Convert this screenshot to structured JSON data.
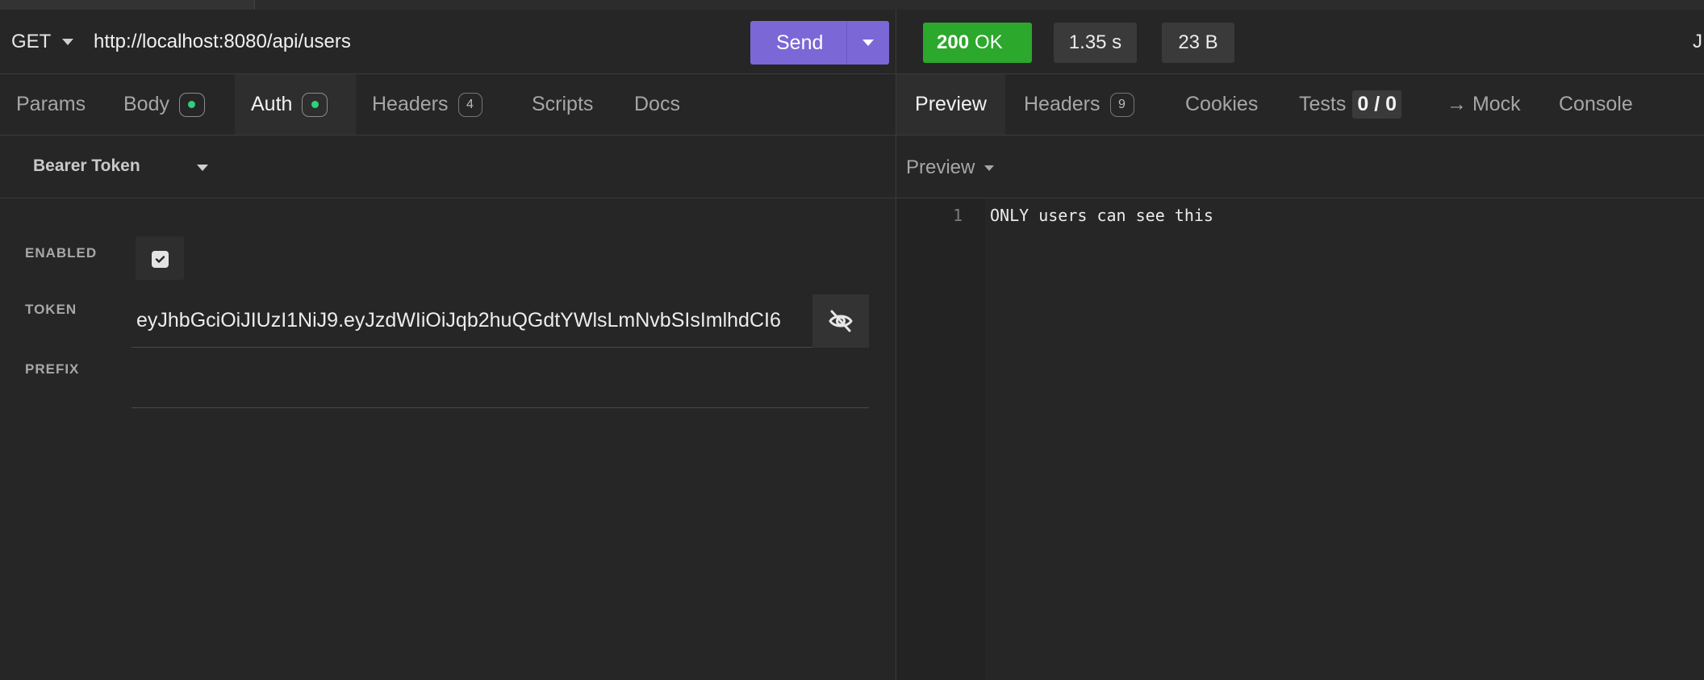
{
  "request": {
    "method": "GET",
    "url": "http://localhost:8080/api/users",
    "send_label": "Send"
  },
  "request_tabs": [
    {
      "label": "Params"
    },
    {
      "label": "Body",
      "badge": "dot"
    },
    {
      "label": "Auth",
      "badge": "dot",
      "active": true
    },
    {
      "label": "Headers",
      "badge": "4"
    },
    {
      "label": "Scripts"
    },
    {
      "label": "Docs"
    }
  ],
  "auth": {
    "type_label": "Bearer Token",
    "enabled_label": "ENABLED",
    "enabled": true,
    "token_label": "TOKEN",
    "token_value": "eyJhbGciOiJIUzI1NiJ9.eyJzdWIiOiJqb2huQGdtYWlsLmNvbSIsImlhdCI6",
    "prefix_label": "PREFIX",
    "prefix_value": ""
  },
  "response": {
    "status_code": "200",
    "status_text": "OK",
    "time": "1.35 s",
    "size": "23 B",
    "edge_letter": "J"
  },
  "response_tabs": [
    {
      "label": "Preview",
      "active": true
    },
    {
      "label": "Headers",
      "badge": "9"
    },
    {
      "label": "Cookies"
    },
    {
      "label": "Tests",
      "count": "0 / 0"
    },
    {
      "label": "→ Mock"
    },
    {
      "label": "Console"
    }
  ],
  "preview": {
    "mode_label": "Preview",
    "lines": [
      {
        "number": "1",
        "text": "ONLY users can see this"
      }
    ]
  },
  "colors": {
    "accent": "#7b68d6",
    "status_ok": "#2ca82c",
    "badge_dot": "#2fd07a"
  },
  "icons": [
    "chevron-down-icon",
    "check-icon",
    "eye-off-icon"
  ]
}
